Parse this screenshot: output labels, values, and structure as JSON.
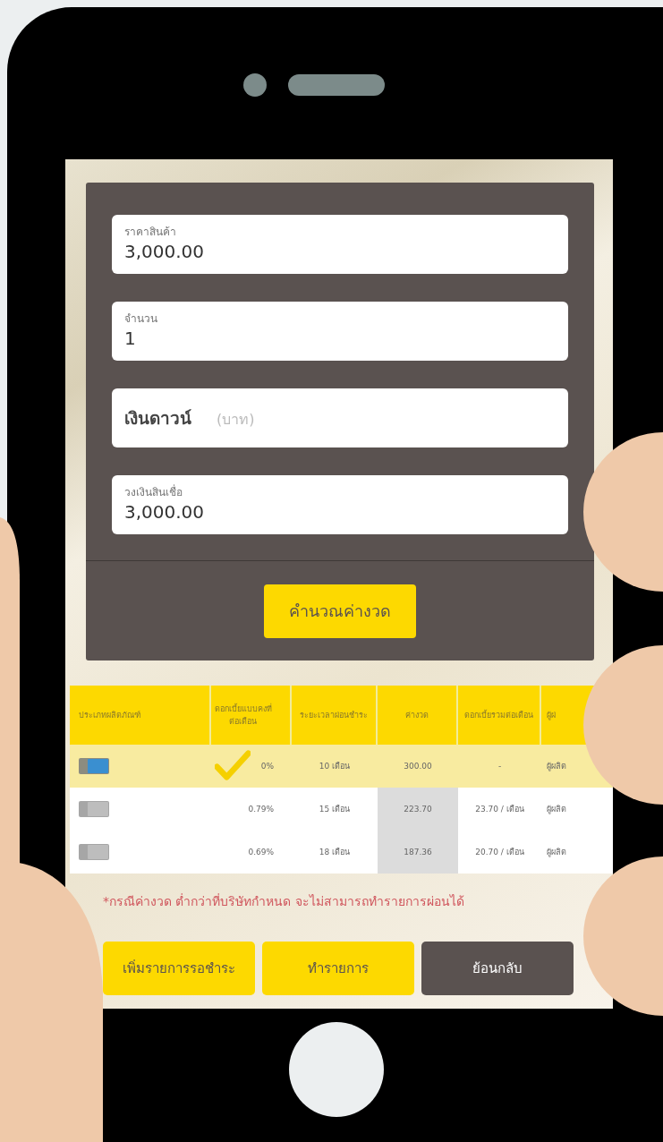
{
  "form": {
    "fields": [
      {
        "kind": "floating",
        "label": "ราคาสินค้า",
        "value": "3,000.00"
      },
      {
        "kind": "floating",
        "label": "จำนวน",
        "value": "1"
      },
      {
        "kind": "inline",
        "label": "เงินดาวน์",
        "placeholder": "(บาท)"
      },
      {
        "kind": "floating",
        "label": "วงเงินสินเชื่อ",
        "value": "3,000.00"
      }
    ],
    "calculate_button": "คำนวณค่างวด"
  },
  "table": {
    "columns": [
      "ประเภทผลิตภัณฑ์",
      "ดอกเบี้ยแบบคงที่ต่อเดือน",
      "ระยะเวลาผ่อนชำระ",
      "ค่างวด",
      "ดอกเบี้ยรวมต่อเดือน",
      "ผู้ผ่"
    ],
    "rows": [
      {
        "selected": true,
        "cells": [
          "",
          "0%",
          "10 เดือน",
          "300.00",
          "-",
          "ผู้ผลิต"
        ]
      },
      {
        "selected": false,
        "cells": [
          "",
          "0.79%",
          "15 เดือน",
          "223.70",
          "23.70 / เดือน",
          "ผู้ผลิต"
        ]
      },
      {
        "selected": false,
        "cells": [
          "",
          "0.69%",
          "18 เดือน",
          "187.36",
          "20.70 / เดือน",
          "ผู้ผลิต"
        ]
      }
    ]
  },
  "note": "*กรณีค่างวด ต่ำกว่าที่บริษัทกำหนด จะไม่สามารถทำรายการผ่อนได้",
  "buttons": [
    {
      "kind": "primary",
      "label": "เพิ่มรายการรอชำระ"
    },
    {
      "kind": "primary",
      "label": "ทำรายการ"
    },
    {
      "kind": "secondary",
      "label": "ย้อนกลับ"
    }
  ]
}
